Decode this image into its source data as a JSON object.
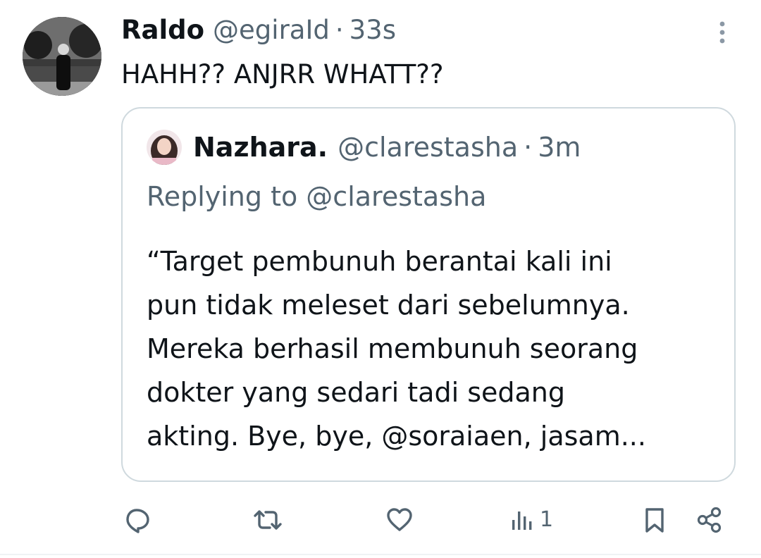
{
  "tweet": {
    "author_name": "Raldo",
    "author_handle": "@egiraId",
    "separator": "·",
    "time": "33s",
    "text": "HAHH?? ANJRR WHATT??"
  },
  "quote": {
    "author_name": "Nazhara.",
    "author_handle": "@clarestasha",
    "separator": "·",
    "time": "3m",
    "replying_to": "Replying to @clarestasha",
    "body_lines": [
      "“Target pembunuh berantai kali ini",
      "pun tidak meleset dari sebelumnya.",
      "Mereka berhasil membunuh seorang",
      "dokter yang sedari tadi sedang",
      "akting. Bye, bye, @soraiaen, jasam..."
    ]
  },
  "actions": {
    "views_count": "1"
  },
  "icons": {
    "more": "more-vertical-icon",
    "reply": "reply-icon",
    "retweet": "retweet-icon",
    "like": "heart-icon",
    "views": "analytics-icon",
    "bookmark": "bookmark-icon",
    "share": "share-icon"
  },
  "colors": {
    "text": "#0f1419",
    "secondary": "#536471",
    "border": "#cfd9de"
  }
}
